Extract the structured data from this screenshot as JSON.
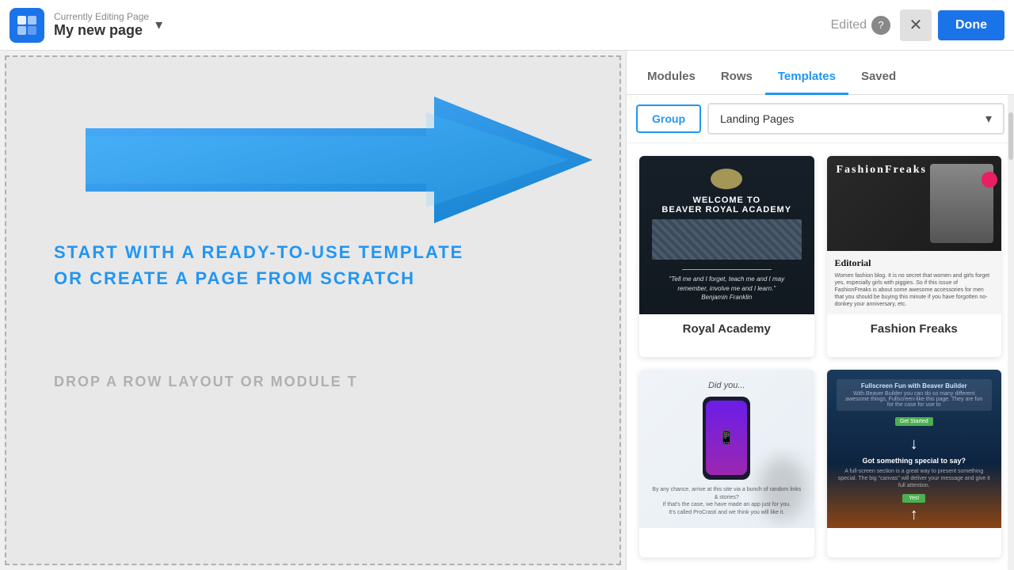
{
  "header": {
    "logo_alt": "Beaver Builder logo",
    "currently_editing_label": "Currently Editing Page",
    "page_name": "My new page",
    "dropdown_icon": "▾",
    "edited_label": "Edited",
    "help_label": "?",
    "close_label": "✕",
    "done_label": "Done"
  },
  "panel": {
    "tabs": [
      {
        "id": "modules",
        "label": "Modules"
      },
      {
        "id": "rows",
        "label": "Rows"
      },
      {
        "id": "templates",
        "label": "Templates"
      },
      {
        "id": "saved",
        "label": "Saved"
      }
    ],
    "active_tab": "templates",
    "filter_buttons": [
      {
        "id": "group",
        "label": "Group",
        "active": true
      },
      {
        "id": "landing_pages",
        "label": "Landing Pages",
        "active": false
      }
    ],
    "dropdown_label": "Landing Pages",
    "dropdown_chevron": "▾",
    "templates": [
      {
        "id": "royal-academy",
        "label": "Royal Academy",
        "type": "royal"
      },
      {
        "id": "fashion-freaks",
        "label": "Fashion Freaks",
        "type": "fashion"
      },
      {
        "id": "app-template",
        "label": "",
        "type": "app"
      },
      {
        "id": "fullscreen-beaver",
        "label": "",
        "type": "fullscreen"
      }
    ]
  },
  "canvas": {
    "main_text_line1": "START WITH A READY-TO-USE TEMPLATE",
    "main_text_line2": "OR CREATE A PAGE FROM SCRATCH",
    "drop_text": "DROP A ROW LAYOUT OR MODULE T"
  }
}
